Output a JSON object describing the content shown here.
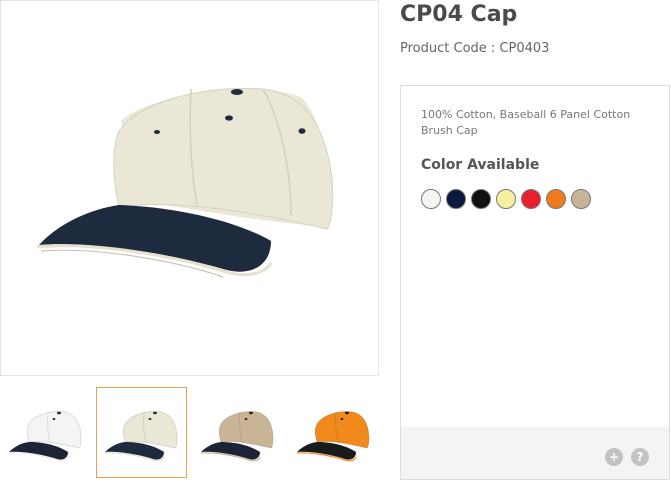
{
  "product": {
    "title": "CP04 Cap",
    "code": "Product Code : CP0403",
    "description": "100% Cotton, Baseball 6 Panel Cotton Brush Cap",
    "color_heading": "Color Available"
  },
  "main_image": {
    "crown_color": "#ebe7d6",
    "visor_color": "#1e2a3e",
    "trim_color": "#e5e1cd"
  },
  "thumbnails": [
    {
      "crown": "#f4f4f4",
      "visor": "#1d2436",
      "trim": "#eeeeee",
      "active": false
    },
    {
      "crown": "#ebe7d6",
      "visor": "#1e2a3e",
      "trim": "#e5e1cd",
      "active": true
    },
    {
      "crown": "#c9b596",
      "visor": "#1d2436",
      "trim": "#c9b596",
      "active": false
    },
    {
      "crown": "#f08a1c",
      "visor": "#1a1a1a",
      "trim": "#f08a1c",
      "active": false
    }
  ],
  "colors": [
    "#f5f5f5",
    "#0e1a3d",
    "#111111",
    "#f7f0a0",
    "#e8202b",
    "#f07a1f",
    "#c7b49b"
  ],
  "footer": {
    "plus": "+",
    "help": "?"
  },
  "accent": "#e5a04b"
}
